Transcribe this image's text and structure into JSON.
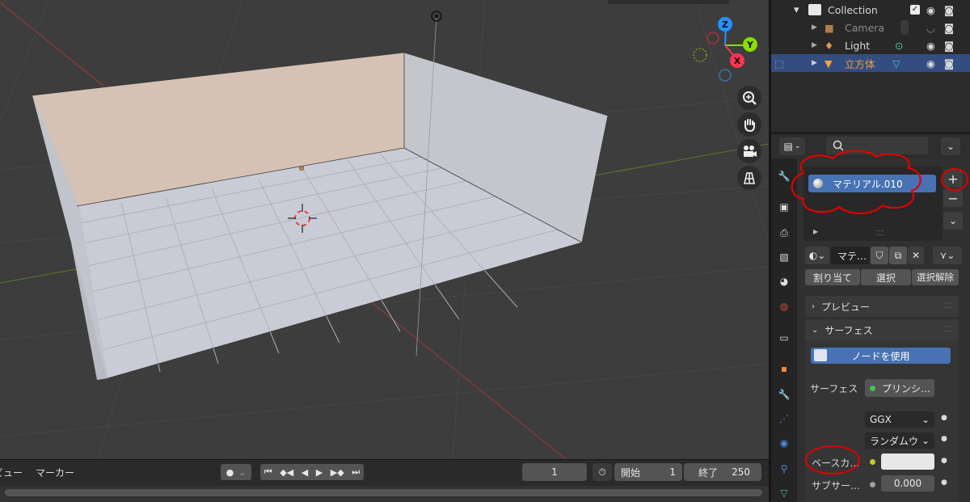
{
  "colors": {
    "viewport_bg": "#3d3d3d",
    "selection_blue": "#334d80",
    "accent_button": "#4772b3",
    "annotation_red": "#e00000",
    "x_axis": "#ff3352",
    "y_axis": "#8bdc00",
    "z_axis": "#2890ff"
  },
  "viewport": {
    "gizmo": {
      "x_label": "X",
      "y_label": "Y",
      "z_label": "Z"
    },
    "nav_buttons": [
      "zoom-icon",
      "hand-pan-icon",
      "camera-icon",
      "grid-icon"
    ]
  },
  "timeline": {
    "menu_view": "ビュー",
    "menu_marker": "マーカー",
    "current_frame": "1",
    "start_label": "開始",
    "start_value": "1",
    "end_label": "終了",
    "end_value": "250"
  },
  "outliner": {
    "rows": [
      {
        "label": "Collection",
        "icon": "collection-icon"
      },
      {
        "label": "Camera",
        "icon": "camera-object-icon"
      },
      {
        "label": "Light",
        "icon": "light-object-icon"
      },
      {
        "label": "立方体",
        "icon": "mesh-object-icon",
        "selected": true
      }
    ]
  },
  "properties": {
    "search_placeholder": "",
    "material_slot": "マテリアル.010",
    "material_name": "マテ…",
    "assign": "割り当て",
    "select": "選択",
    "deselect": "選択解除",
    "preview_panel": "プレビュー",
    "surface_panel": "サーフェス",
    "use_nodes": "ノードを使用",
    "surface_label": "サーフェス",
    "surface_value": "プリンシ…",
    "distribution": "GGX",
    "subsurface_method": "ランダムウ",
    "base_color_label": "ベースカ…",
    "base_color": "#e8e8e8",
    "subsurface_label": "サブサー…",
    "subsurface_value": "0.000"
  }
}
